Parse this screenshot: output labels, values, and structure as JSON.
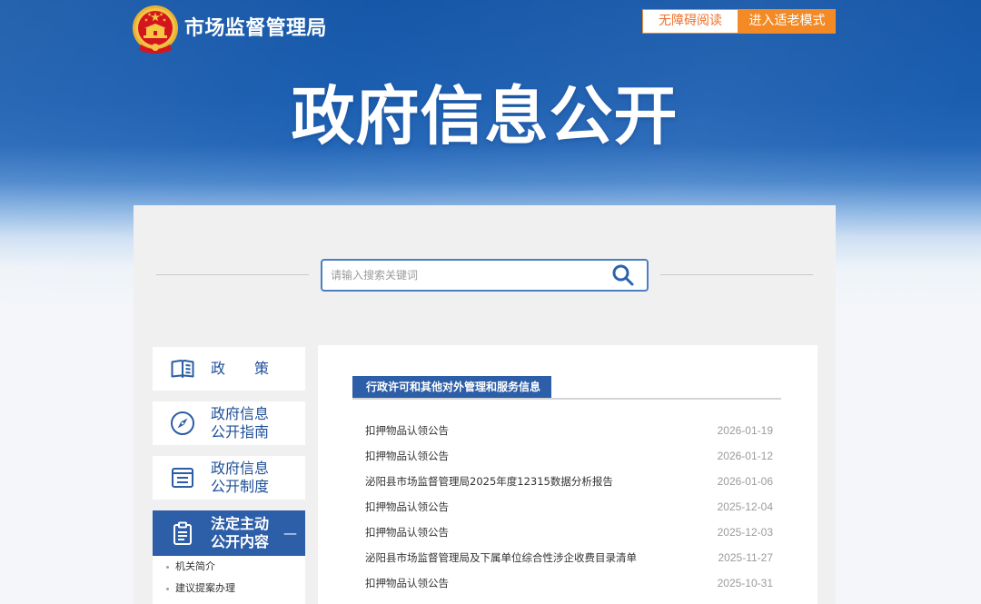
{
  "header": {
    "site_name": "市场监督管理局",
    "emblem_icon": "national-emblem-icon",
    "buttons": {
      "accessible_reading": "无障碍阅读",
      "elder_mode": "进入适老模式"
    },
    "banner_title": "政府信息公开"
  },
  "search": {
    "placeholder": "请输入搜索关键词",
    "value": "",
    "icon": "search-icon"
  },
  "sidebar": {
    "items": [
      {
        "label": [
          "政　　策"
        ],
        "icon": "book-icon",
        "active": false
      },
      {
        "label": [
          "政府信息",
          "公开指南"
        ],
        "icon": "compass-icon",
        "active": false
      },
      {
        "label": [
          "政府信息",
          "公开制度"
        ],
        "icon": "list-icon",
        "active": false
      },
      {
        "label": [
          "法定主动",
          "公开内容"
        ],
        "icon": "clipboard-icon",
        "active": true,
        "toggle": "—"
      }
    ],
    "sub_items": [
      "机关简介",
      "建议提案办理"
    ]
  },
  "main": {
    "active_tab": "行政许可和其他对外管理和服务信息",
    "articles": [
      {
        "title": "扣押物品认领公告",
        "date": "2026-01-19"
      },
      {
        "title": "扣押物品认领公告",
        "date": "2026-01-12"
      },
      {
        "title": "泌阳县市场监督管理局2025年度12315数据分析报告",
        "date": "2026-01-06"
      },
      {
        "title": "扣押物品认领公告",
        "date": "2025-12-04"
      },
      {
        "title": "扣押物品认领公告",
        "date": "2025-12-03"
      },
      {
        "title": "泌阳县市场监督管理局及下属单位综合性涉企收费目录清单",
        "date": "2025-11-27"
      },
      {
        "title": "扣押物品认领公告",
        "date": "2025-10-31"
      }
    ]
  },
  "theme": {
    "header_blue": "#1657a8",
    "primary_blue": "#2d5ea8",
    "accent_orange": "#f38a25",
    "panel_gray": "#f0f0f0",
    "title_text": "#333333",
    "date_text": "#9b9b9b"
  }
}
